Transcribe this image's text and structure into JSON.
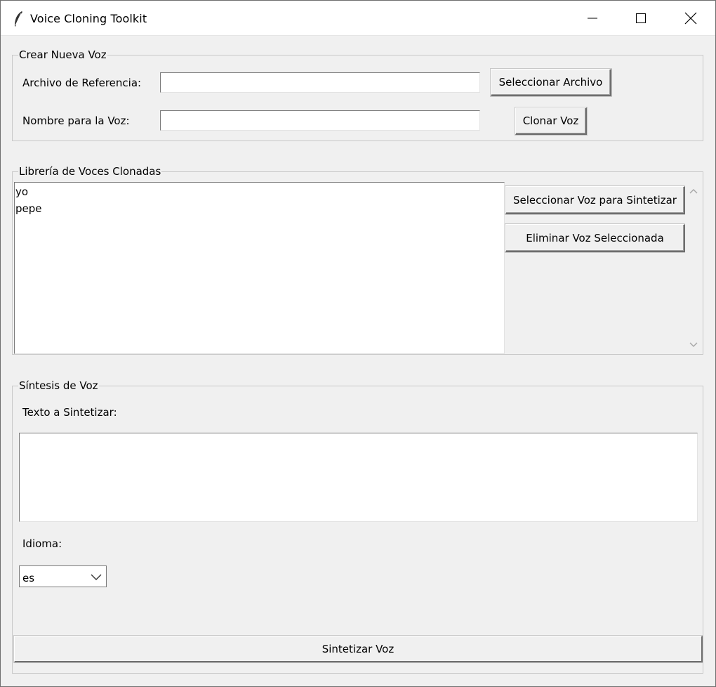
{
  "window": {
    "title": "Voice Cloning Toolkit",
    "minimize_glyph": "—",
    "maximize_glyph": "☐",
    "close_glyph": "✕"
  },
  "create_group": {
    "legend": "Crear Nueva Voz",
    "reference_label": "Archivo de Referencia:",
    "reference_value": "",
    "select_file_button": "Seleccionar Archivo",
    "name_label": "Nombre para la Voz:",
    "name_value": "",
    "clone_button": "Clonar Voz"
  },
  "library_group": {
    "legend": "Librería de Voces Clonadas",
    "voices": [
      "yo",
      "pepe"
    ],
    "select_voice_button": "Seleccionar Voz para Sintetizar",
    "delete_voice_button": "Eliminar Voz Seleccionada"
  },
  "synthesis_group": {
    "legend": "Síntesis de Voz",
    "text_label": "Texto a Sintetizar:",
    "text_value": "",
    "language_label": "Idioma:",
    "language_value": "es",
    "synthesize_button": "Sintetizar Voz"
  },
  "icons": {
    "app": "feather-icon",
    "scroll_up": "chevron-up-icon",
    "scroll_down": "chevron-down-icon",
    "combo_arrow": "chevron-down-icon"
  }
}
